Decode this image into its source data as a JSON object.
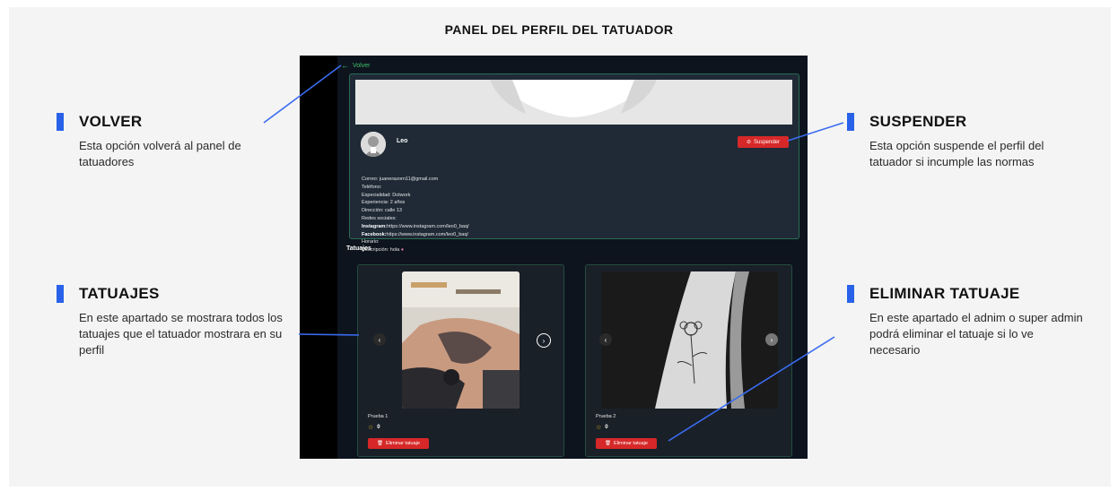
{
  "page_title": "PANEL DEL PERFIL DEL TATUADOR",
  "annotations": {
    "volver": {
      "title": "VOLVER",
      "text": "Esta opción volverá al panel de tatuadores"
    },
    "suspender": {
      "title": "SUSPENDER",
      "text": "Esta opción suspende el perfil del tatuador si incumple las normas"
    },
    "tatuajes": {
      "title": "TATUAJES",
      "text": "En este apartado se mostrara todos los tatuajes que el tatuador mostrara en su perfil"
    },
    "eliminar": {
      "title": "ELIMINAR TATUAJE",
      "text": "En este apartado el adnim o super admin podrá eliminar el tatuaje si lo ve necesario"
    }
  },
  "app": {
    "back_label": "Volver",
    "profile": {
      "name": "Leo",
      "suspend_label": "Suspender",
      "correo": "Correo: juanerazorn11@gmail.com",
      "telefono": "Teléfono:",
      "especialidad": "Especialidad: Dotwork",
      "experiencia": "Experiencia: 2 años",
      "direccion": "Dirección: calle 13",
      "redes": "Redes sociales:",
      "instagram_label": "Instagram:",
      "instagram_url": "https://www.instagram.com/leo0_baq/",
      "facebook_label": "Facebook:",
      "facebook_url": "https://www.instagram.com/leo0_baq/",
      "horario": "Horario:",
      "descripcion": "Descripción: hola"
    },
    "section_title": "Tatuajes",
    "tattoos": [
      {
        "name": "Prueba 1",
        "rating": "0",
        "delete_label": "Eliminar tatuaje"
      },
      {
        "name": "Prueba 2",
        "rating": "0",
        "delete_label": "Eliminar tatuaje"
      }
    ]
  }
}
